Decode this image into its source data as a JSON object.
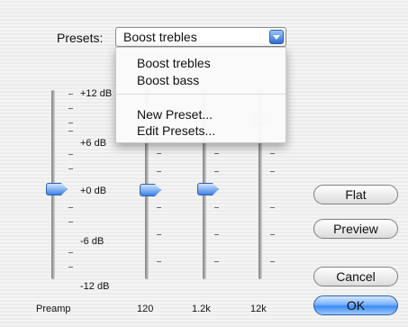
{
  "presets": {
    "label": "Presets:",
    "selected": "Boost trebles",
    "menu": [
      "Boost trebles",
      "Boost bass",
      "New Preset...",
      "Edit Presets..."
    ]
  },
  "scale": {
    "labels": [
      "+12 dB",
      "+6 dB",
      "+0 dB",
      "-6 dB",
      "-12 dB"
    ]
  },
  "bands": {
    "labels": [
      "Preamp",
      "120",
      "1.2k",
      "12k"
    ]
  },
  "buttons": {
    "flat": "Flat",
    "preview": "Preview",
    "cancel": "Cancel",
    "ok": "OK"
  },
  "colors": {
    "accent": "#3d82e6"
  }
}
